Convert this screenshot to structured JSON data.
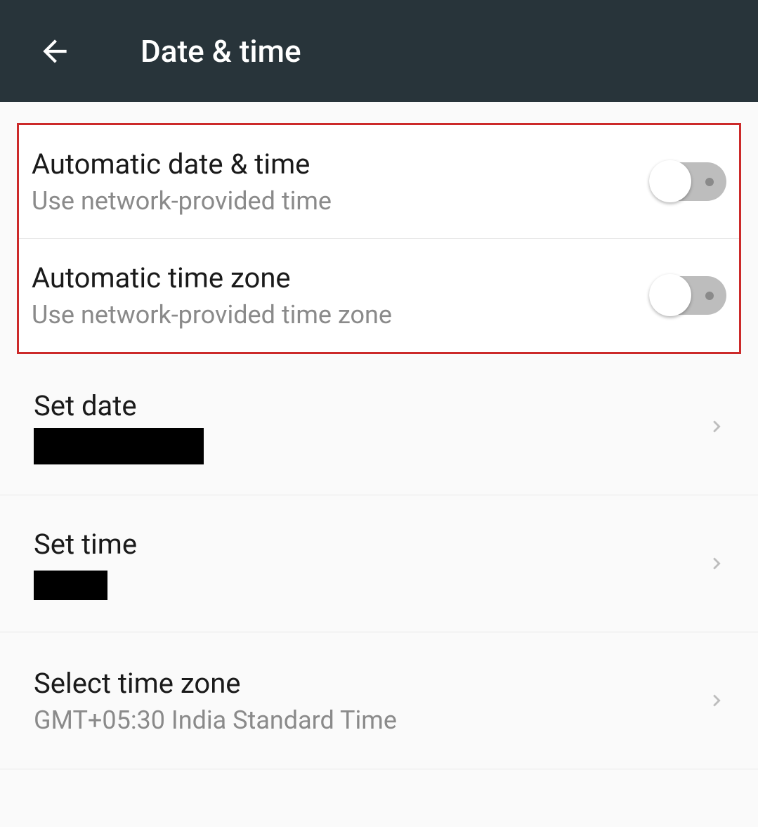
{
  "header": {
    "title": "Date & time"
  },
  "settings": {
    "auto_date_time": {
      "title": "Automatic date & time",
      "subtitle": "Use network-provided time"
    },
    "auto_time_zone": {
      "title": "Automatic time zone",
      "subtitle": "Use network-provided time zone"
    },
    "set_date": {
      "title": "Set date"
    },
    "set_time": {
      "title": "Set time"
    },
    "select_time_zone": {
      "title": "Select time zone",
      "subtitle": "GMT+05:30 India Standard Time"
    }
  }
}
